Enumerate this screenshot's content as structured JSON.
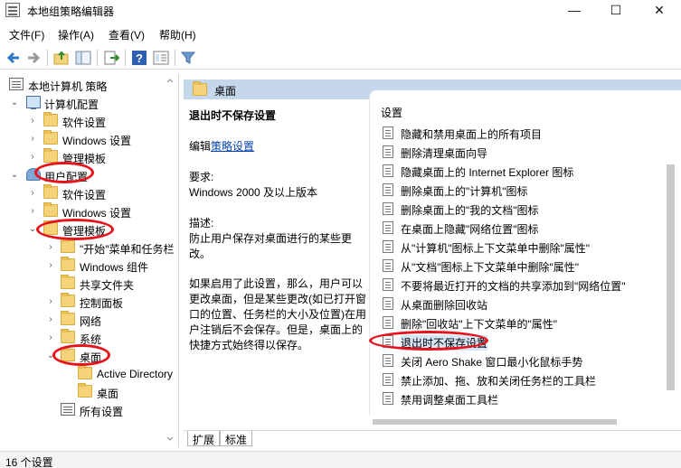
{
  "window": {
    "title": "本地组策略编辑器",
    "minimize": "—",
    "maximize": "☐",
    "close": "✕"
  },
  "menu": {
    "file": "文件(F)",
    "action": "操作(A)",
    "view": "查看(V)",
    "help": "帮助(H)"
  },
  "toolbar": {
    "icons": [
      "back-icon",
      "forward-icon",
      "up-folder-icon",
      "show-hide-tree-icon",
      "export-list-icon",
      "help-icon",
      "properties-icon",
      "filter-icon"
    ]
  },
  "tree": {
    "root": "本地计算机 策略",
    "computer_config": "计算机配置",
    "cc_software": "软件设置",
    "cc_windows": "Windows 设置",
    "cc_admin": "管理模板",
    "user_config": "用户配置",
    "uc_software": "软件设置",
    "uc_windows": "Windows 设置",
    "uc_admin": "管理模板",
    "start_menu": "\"开始\"菜单和任务栏",
    "windows_components": "Windows 组件",
    "shared_folders": "共享文件夹",
    "control_panel": "控制面板",
    "network": "网络",
    "system": "系统",
    "desktop": "桌面",
    "active_directory": "Active Directory",
    "desktop_sub": "桌面",
    "all_settings": "所有设置"
  },
  "header": {
    "title": "桌面"
  },
  "description": {
    "title": "退出时不保存设置",
    "edit_prefix": "编辑",
    "edit_link": "策略设置",
    "requirements_label": "要求:",
    "requirements_value": "Windows 2000 及以上版本",
    "description_label": "描述:",
    "description_text": "防止用户保存对桌面进行的某些更改。",
    "detail_text": "如果启用了此设置，那么，用户可以更改桌面，但是某些更改(如已打开窗口的位置、任务栏的大小及位置)在用户注销后不会保存。但是，桌面上的快捷方式始终得以保存。"
  },
  "list": {
    "column_header": "设置",
    "items": [
      "隐藏和禁用桌面上的所有项目",
      "删除清理桌面向导",
      "隐藏桌面上的 Internet Explorer 图标",
      "删除桌面上的\"计算机\"图标",
      "删除桌面上的\"我的文档\"图标",
      "在桌面上隐藏\"网络位置\"图标",
      "从\"计算机\"图标上下文菜单中删除\"属性\"",
      "从\"文档\"图标上下文菜单中删除\"属性\"",
      "不要将最近打开的文档的共享添加到\"网络位置\"",
      "从桌面删除回收站",
      "删除\"回收站\"上下文菜单的\"属性\"",
      "退出时不保存设置",
      "关闭 Aero Shake 窗口最小化鼠标手势",
      "禁止添加、拖、放和关闭任务栏的工具栏",
      "禁用调整桌面工具栏"
    ]
  },
  "tabs": {
    "extended": "扩展",
    "standard": "标准"
  },
  "status": {
    "text": "16 个设置"
  },
  "colors": {
    "header_band": "#c5d7ea",
    "annotation": "#e8121b",
    "link": "#0645ad"
  }
}
